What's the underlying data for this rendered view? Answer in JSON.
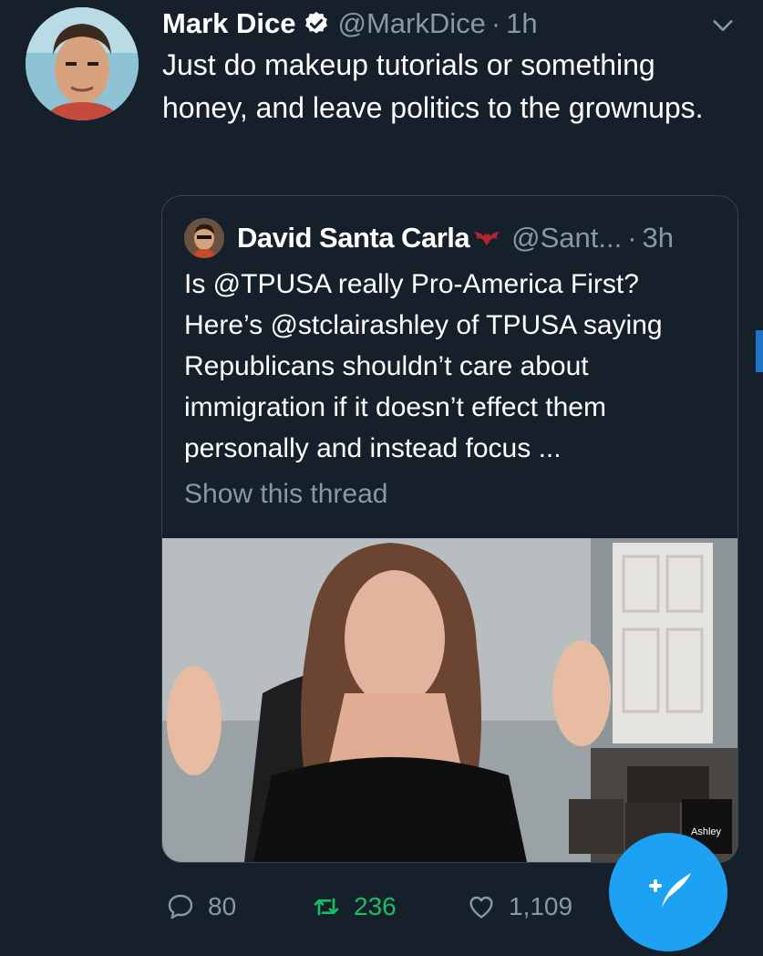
{
  "tweet": {
    "author_name": "Mark Dice",
    "handle": "@MarkDice",
    "separator": "·",
    "time": "1h",
    "text": "Just do makeup tutorials or something honey, and leave politics to the grownups."
  },
  "quoted_tweet": {
    "author_name": "David Santa Carla",
    "handle": "@Sant...",
    "separator": "·",
    "time": "3h",
    "text": "Is @TPUSA really Pro-America First? Here’s @stclairashley of TPUSA saying Republicans shouldn’t care about immigration if it doesn’t effect them personally and instead focus ...",
    "show_thread": "Show this thread",
    "video_overlay_label": "Ashley"
  },
  "actions": {
    "replies": "80",
    "retweets": "236",
    "likes": "1,109"
  },
  "icons": {
    "verified": "verified-badge-icon",
    "chevron": "chevron-down-icon",
    "reply": "reply-icon",
    "retweet": "retweet-icon",
    "like": "heart-icon",
    "compose": "compose-tweet-icon",
    "bat": "bat-emoji-icon"
  },
  "colors": {
    "background": "#15202b",
    "secondary_text": "#8899a6",
    "retweet_active": "#17bf63",
    "accent": "#1da1f2"
  }
}
